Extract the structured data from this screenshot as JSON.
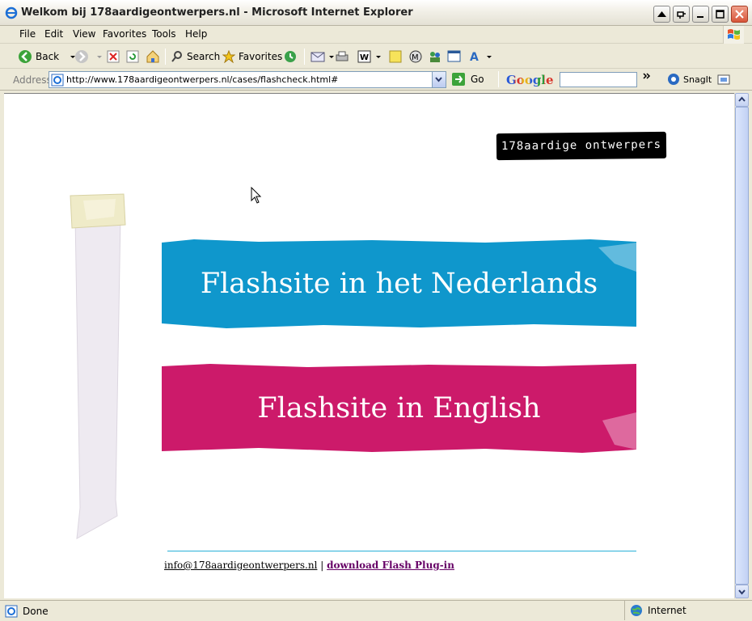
{
  "window": {
    "title": "Welkom bij 178aardigeontwerpers.nl - Microsoft Internet Explorer"
  },
  "menu": {
    "items": [
      "File",
      "Edit",
      "View",
      "Favorites",
      "Tools",
      "Help"
    ]
  },
  "toolbar": {
    "back_label": "Back",
    "search_label": "Search",
    "favorites_label": "Favorites"
  },
  "address": {
    "label": "Address",
    "url": "http://www.178aardigeontwerpers.nl/cases/flashcheck.html#",
    "go_label": "Go",
    "google_label": "Google",
    "snagit_label": "SnagIt"
  },
  "page": {
    "logo_text": "178aardige ontwerpers",
    "banner_nl": "Flashsite in het Nederlands",
    "banner_en": "Flashsite in English",
    "email_link": "info@178aardigeontwerpers.nl",
    "separator": "|",
    "flash_link": "download Flash Plug-in",
    "colors": {
      "blue": "#0f97cc",
      "magenta": "#cc1a6a"
    }
  },
  "status": {
    "text": "Done",
    "zone": "Internet"
  }
}
